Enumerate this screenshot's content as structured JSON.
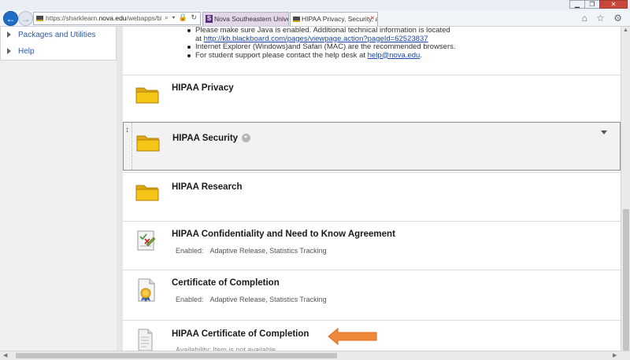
{
  "browser": {
    "url_prefix": "https://sharklearn.",
    "url_domain": "nova.edu",
    "url_suffix": "/webapps/blackboard/cont",
    "address_icons": "⌕ ▾ 🔒 ↻",
    "tabs": [
      {
        "label": "Nova Southeastern University ..."
      },
      {
        "label": "HIPAA Privacy, Security, an..."
      }
    ],
    "tab_close": "×",
    "toolbar_icons": "⌂ ☆ ⚙"
  },
  "sidebar": {
    "items": [
      {
        "label": "Packages and Utilities"
      },
      {
        "label": "Help"
      }
    ]
  },
  "notice": {
    "line1": "Please make sure Java is enabled. Additional technical information is located",
    "line1b_prefix": "at ",
    "line1b_link": "http://kb.blackboard.com/pages/viewpage.action?pageId=62523837",
    "line2": "Internet Explorer (Windows)and Safari (MAC) are the recommended browsers.",
    "line3_prefix": "For student support please contact the help desk at ",
    "line3_link": "help@nova.edu",
    "line3_suffix": "."
  },
  "content_items": [
    {
      "title": "HIPAA Privacy",
      "icon": "folder-icon"
    },
    {
      "title": "HIPAA Security",
      "icon": "folder-icon"
    },
    {
      "title": "HIPAA Research",
      "icon": "folder-icon"
    },
    {
      "title": "HIPAA Confidentiality and Need to Know Agreement",
      "icon": "assessment-icon",
      "status_label": "Enabled:",
      "status_value": "Adaptive Release, Statistics Tracking"
    },
    {
      "title": "Certificate of Completion",
      "icon": "certificate-icon",
      "status_label": "Enabled:",
      "status_value": "Adaptive Release, Statistics Tracking"
    },
    {
      "title": "HIPAA Certificate of Completion",
      "icon": "document-icon",
      "faded_text": "Availability:  Item is not available."
    }
  ],
  "colors": {
    "folder": "#f5c518",
    "arrow": "#f0883a",
    "link": "#1a47a8",
    "back_button": "#1f6fc9"
  }
}
